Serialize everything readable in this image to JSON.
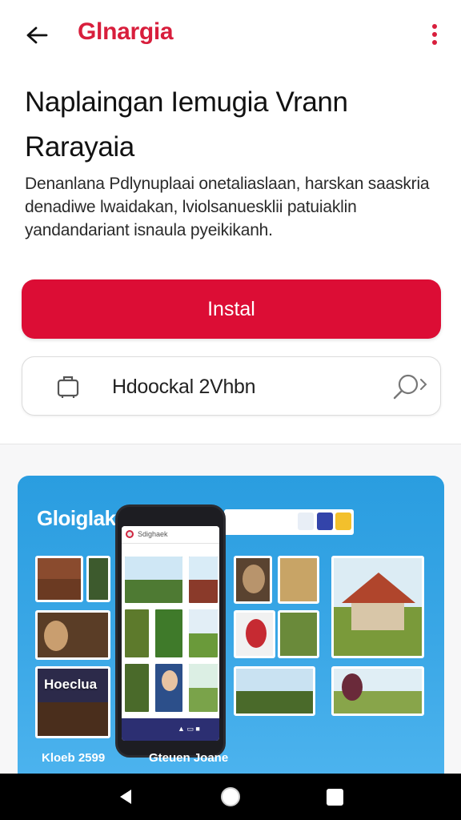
{
  "app_bar": {
    "title": "Glnargia",
    "back_icon": "arrow-left-icon",
    "more_icon": "more-vert-icon",
    "title_color": "#d81e3c"
  },
  "headline": "Naplaingan Iemugia Vrann Rarayaia",
  "description": "Denanlana Pdlynuplaai onetaliaslaan, harskan saaskria denadiwe lwaidakan, lviolsanuesklii patuiaklin yandandariant isnaula pyeikikanh.",
  "install_button": {
    "label": "Instal",
    "color": "#dc0d35"
  },
  "secondary_button": {
    "label": "Hdoockal 2Vhbn",
    "lead_icon": "luggage-icon",
    "trail_icon": "magnifier-arrow-icon"
  },
  "promo": {
    "brand": "Gloiglak",
    "tile_label": "Hoeclua",
    "caption_left": "Kloeb 2599",
    "caption_right": "Gteuen Joane",
    "phone_url": "Sdighaek",
    "background_color": "#2a9de0"
  },
  "system_nav": {
    "back_icon": "nav-back-triangle-icon",
    "home_icon": "nav-home-circle-icon",
    "recents_icon": "nav-recents-square-icon"
  }
}
